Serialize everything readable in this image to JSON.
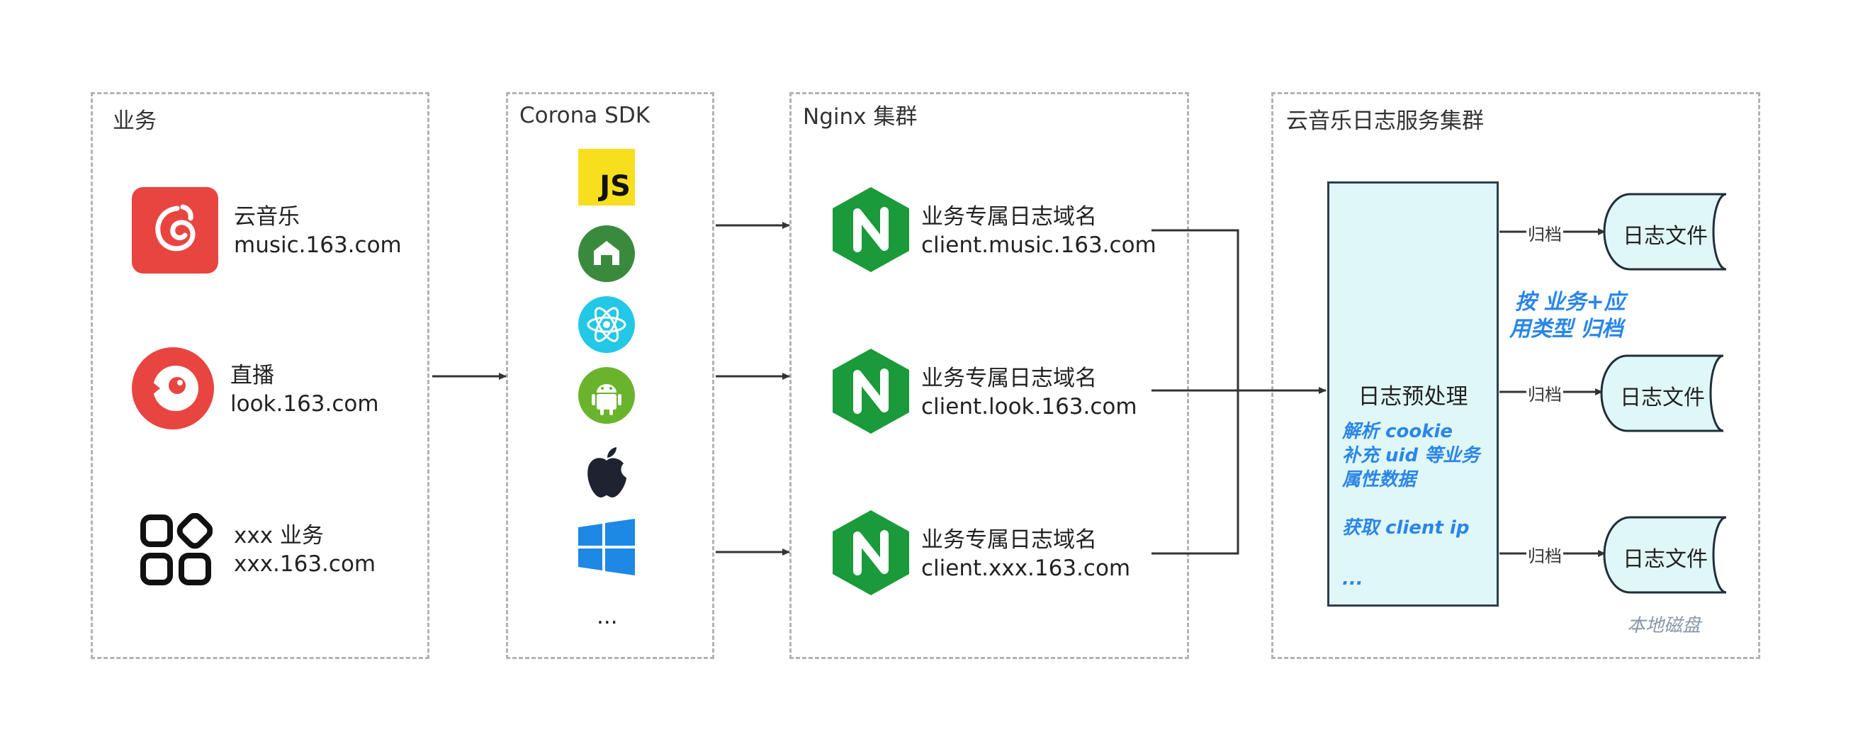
{
  "groups": {
    "business": {
      "title": "业务"
    },
    "sdk": {
      "title": "Corona SDK",
      "more": "..."
    },
    "nginx": {
      "title": "Nginx 集群"
    },
    "log_service": {
      "title": "云音乐日志服务集群"
    }
  },
  "apps": [
    {
      "name": "云音乐",
      "domain": "music.163.com",
      "icon": "cloud-music-icon",
      "color": "#e94540"
    },
    {
      "name": "直播",
      "domain": "look.163.com",
      "icon": "live-stream-icon",
      "color": "#e94540"
    },
    {
      "name": "xxx 业务",
      "domain": "xxx.163.com",
      "icon": "apps-grid-icon",
      "color": "#111111"
    }
  ],
  "sdk_icons": [
    {
      "icon": "javascript-icon",
      "text": "JS",
      "color": "#f7df1e"
    },
    {
      "icon": "nuxt-icon",
      "color": "#3a8a3e"
    },
    {
      "icon": "react-icon",
      "color": "#22c8e5"
    },
    {
      "icon": "android-icon",
      "color": "#6ab42d"
    },
    {
      "icon": "apple-icon",
      "color": "#1f2230"
    },
    {
      "icon": "windows-icon",
      "color": "#1e88e5"
    }
  ],
  "nginx_nodes": [
    {
      "title": "业务专属日志域名",
      "domain": "client.music.163.com",
      "icon": "nginx-icon",
      "color": "#1a9a3a"
    },
    {
      "title": "业务专属日志域名",
      "domain": "client.look.163.com",
      "icon": "nginx-icon",
      "color": "#1a9a3a"
    },
    {
      "title": "业务专属日志域名",
      "domain": "client.xxx.163.com",
      "icon": "nginx-icon",
      "color": "#1a9a3a"
    }
  ],
  "preprocess": {
    "title": "日志预处理",
    "notes": [
      "解析 cookie",
      "补充 uid 等业务",
      "属性数据",
      "获取 client ip",
      "..."
    ]
  },
  "archive_label": "归档",
  "archive_rule": [
    "按 业务+应",
    "用类型 归档"
  ],
  "log_files": [
    "日志文件",
    "日志文件",
    "日志文件"
  ],
  "disk_label": "本地磁盘",
  "colors": {
    "accent": "#2a86e8",
    "box_fill": "#e0f7f7",
    "stroke": "#333333"
  }
}
